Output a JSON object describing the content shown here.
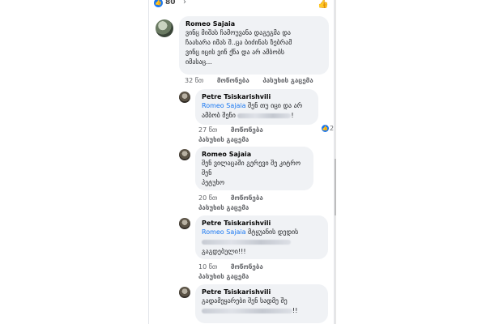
{
  "reactions": {
    "count": "80",
    "icon": "like-reaction-icon"
  },
  "comments": [
    {
      "author": "Romeo Sajaia",
      "lines": [
        "ვინც მიშას ჩამოუვანა დაგეგმა და",
        "ჩაახარა იმას შ..ცა ბიძინას ზებრამ",
        "ვინც იცის ვინ ქნა  და არ ამბობს",
        "იმასაც..."
      ],
      "time": "32 წთ",
      "like_label": "მოწონება",
      "reply_label": "პასუხის გაცემა"
    },
    {
      "author": "Petre Tsiskarishvili",
      "mention": "Romeo Sajaia",
      "line1_rest": " შენ თუ იცი და არ",
      "line2_start": "ამბობ შენი ",
      "line2_end": "!",
      "time": "27 წთ",
      "like_label": "მოწონება",
      "reply_label": "პასუხის გაცემა",
      "reaction_count": "2"
    },
    {
      "author": "Romeo Sajaia",
      "lines": [
        "შენ ვილაცაში გერევი შე კიტრო",
        "შენ",
        "პეტუხო"
      ],
      "time": "20 წთ",
      "like_label": "მოწონება",
      "reply_label": "პასუხის გაცემა"
    },
    {
      "author": "Petre Tsiskarishvili",
      "mention": "Romeo Sajaia",
      "line1_rest": " მტყუანის დედის",
      "line3": "გაგდებული!!!",
      "time": "10 წთ",
      "like_label": "მოწონება",
      "reply_label": "პასუხის გაცემა"
    },
    {
      "author": "Petre Tsiskarishvili",
      "line1": "გადამეყარები შენ სადმე შე",
      "line2_end": "!!"
    }
  ]
}
